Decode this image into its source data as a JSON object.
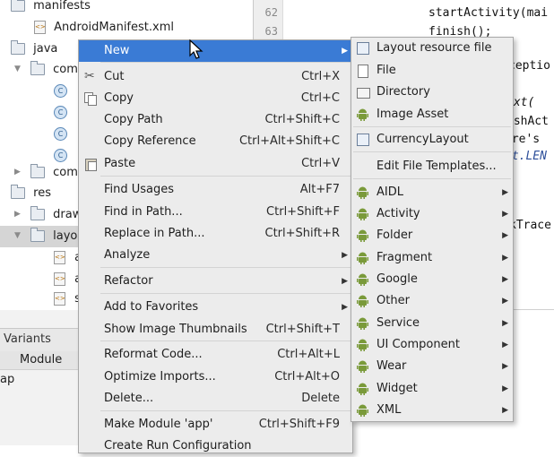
{
  "project_tree": {
    "manifests": "manifests",
    "android_manifest": "AndroidManifest.xml",
    "java": "java",
    "com1": "com.",
    "com2": "com.",
    "res": "res",
    "draw": "draw",
    "layout": "layou",
    "file_a1": "a",
    "file_a2": "a",
    "file_s": "s"
  },
  "build_variants": {
    "title": "Variants",
    "module_header": "Module",
    "module_value": "ap"
  },
  "editor": {
    "line_numbers": [
      "62",
      "63"
    ],
    "lines": [
      "startActivity(mai",
      "finish();",
      "",
      "ceptio",
      "",
      "ext(",
      "ashAct",
      "ere's ",
      "st.LEN",
      "",
      "",
      "kTrace"
    ]
  },
  "main_menu": {
    "items": [
      {
        "label": "New",
        "shortcut": "",
        "submenu": true,
        "icon": ""
      },
      {
        "label": "Cut",
        "shortcut": "Ctrl+X",
        "icon": "scissors-icon"
      },
      {
        "label": "Copy",
        "shortcut": "Ctrl+C",
        "icon": "copy-icon"
      },
      {
        "label": "Copy Path",
        "shortcut": "Ctrl+Shift+C"
      },
      {
        "label": "Copy Reference",
        "shortcut": "Ctrl+Alt+Shift+C"
      },
      {
        "label": "Paste",
        "shortcut": "Ctrl+V",
        "icon": "paste-icon"
      },
      {
        "label": "Find Usages",
        "shortcut": "Alt+F7"
      },
      {
        "label": "Find in Path...",
        "shortcut": "Ctrl+Shift+F"
      },
      {
        "label": "Replace in Path...",
        "shortcut": "Ctrl+Shift+R"
      },
      {
        "label": "Analyze",
        "shortcut": "",
        "submenu": true
      },
      {
        "label": "Refactor",
        "shortcut": "",
        "submenu": true
      },
      {
        "label": "Add to Favorites",
        "shortcut": "",
        "submenu": true
      },
      {
        "label": "Show Image Thumbnails",
        "shortcut": "Ctrl+Shift+T"
      },
      {
        "label": "Reformat Code...",
        "shortcut": "Ctrl+Alt+L"
      },
      {
        "label": "Optimize Imports...",
        "shortcut": "Ctrl+Alt+O"
      },
      {
        "label": "Delete...",
        "shortcut": "Delete"
      },
      {
        "label": "Make Module 'app'",
        "shortcut": "Ctrl+Shift+F9"
      },
      {
        "label": "Create Run Configuration",
        "shortcut": ""
      }
    ]
  },
  "new_submenu": {
    "items": [
      {
        "label": "Layout resource file",
        "icon": "layout-file-icon"
      },
      {
        "label": "File",
        "icon": "file-icon"
      },
      {
        "label": "Directory",
        "icon": "folder-icon"
      },
      {
        "label": "Image Asset",
        "icon": "android-icon"
      },
      {
        "label": "CurrencyLayout",
        "icon": "layout-icon"
      },
      {
        "label": "Edit File Templates...",
        "icon": ""
      },
      {
        "label": "AIDL",
        "icon": "android-icon",
        "submenu": true
      },
      {
        "label": "Activity",
        "icon": "android-icon",
        "submenu": true
      },
      {
        "label": "Folder",
        "icon": "android-icon",
        "submenu": true
      },
      {
        "label": "Fragment",
        "icon": "android-icon",
        "submenu": true
      },
      {
        "label": "Google",
        "icon": "android-icon",
        "submenu": true
      },
      {
        "label": "Other",
        "icon": "android-icon",
        "submenu": true
      },
      {
        "label": "Service",
        "icon": "android-icon",
        "submenu": true
      },
      {
        "label": "UI Component",
        "icon": "android-icon",
        "submenu": true
      },
      {
        "label": "Wear",
        "icon": "android-icon",
        "submenu": true
      },
      {
        "label": "Widget",
        "icon": "android-icon",
        "submenu": true
      },
      {
        "label": "XML",
        "icon": "android-icon",
        "submenu": true
      }
    ]
  },
  "colors": {
    "highlight": "#3a7bd5",
    "menu_bg": "#ececec",
    "android_green": "#7a9a3a"
  }
}
